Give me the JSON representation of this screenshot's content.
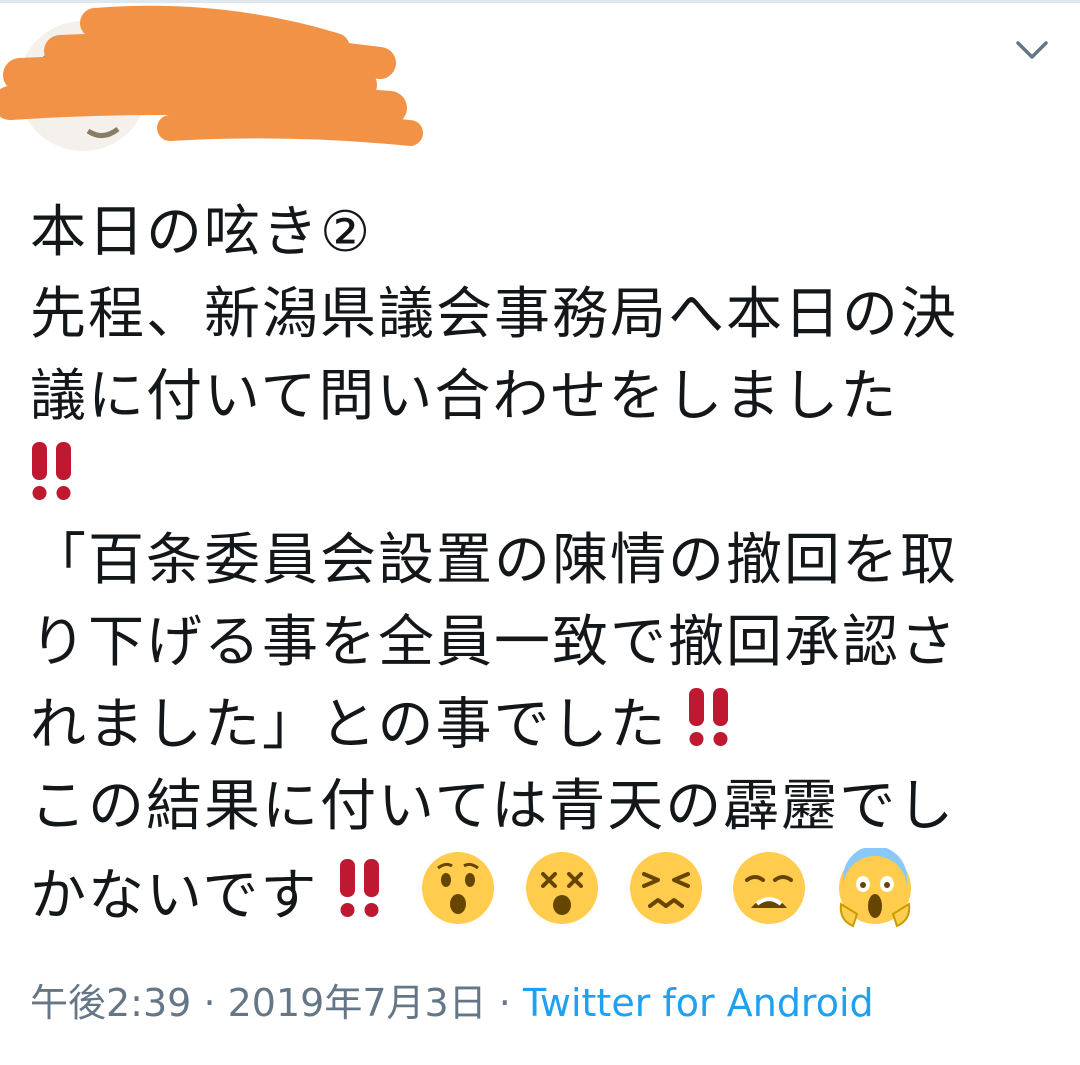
{
  "tweet": {
    "lines": [
      "本日の呟き②",
      "先程、新潟県議会事務局へ本日の決",
      "議に付いて問い合わせをしました",
      "",
      "「百条委員会設置の陳情の撤回を取",
      "り下げる事を全員一致で撤回承認さ",
      "れました」との事でした",
      "この結果に付いては青天の霹靂でし",
      "かないです"
    ],
    "emojis": [
      "hushed-face",
      "dizzy-face",
      "persevering-face",
      "weary-face",
      "screaming-in-fear-face"
    ]
  },
  "meta": {
    "time": "午後2:39",
    "separator": "·",
    "date": "2019年7月3日",
    "source": "Twitter for Android"
  },
  "colors": {
    "text": "#14171a",
    "meta": "#657786",
    "link": "#1da1f2",
    "bang": "#be1931",
    "redaction": "#f29247"
  },
  "icons": {
    "menu": "chevron-down-icon",
    "bang": "double-exclamation-icon"
  }
}
